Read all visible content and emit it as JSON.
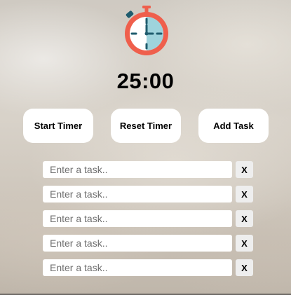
{
  "timer": {
    "display": "25:00"
  },
  "buttons": {
    "start_label": "Start Timer",
    "reset_label": "Reset Timer",
    "add_label": "Add Task"
  },
  "tasks": [
    {
      "placeholder": "Enter a task..",
      "value": "",
      "remove_label": "X"
    },
    {
      "placeholder": "Enter a task..",
      "value": "",
      "remove_label": "X"
    },
    {
      "placeholder": "Enter a task..",
      "value": "",
      "remove_label": "X"
    },
    {
      "placeholder": "Enter a task..",
      "value": "",
      "remove_label": "X"
    },
    {
      "placeholder": "Enter a task..",
      "value": "",
      "remove_label": "X"
    }
  ],
  "icons": {
    "logo": "stopwatch-icon"
  },
  "colors": {
    "stopwatch_ring": "#ef5f4c",
    "stopwatch_face": "#9ed3dc",
    "stopwatch_dark": "#1f5c6e",
    "button_bg": "#ffffff",
    "remove_bg": "#eeeeee"
  }
}
